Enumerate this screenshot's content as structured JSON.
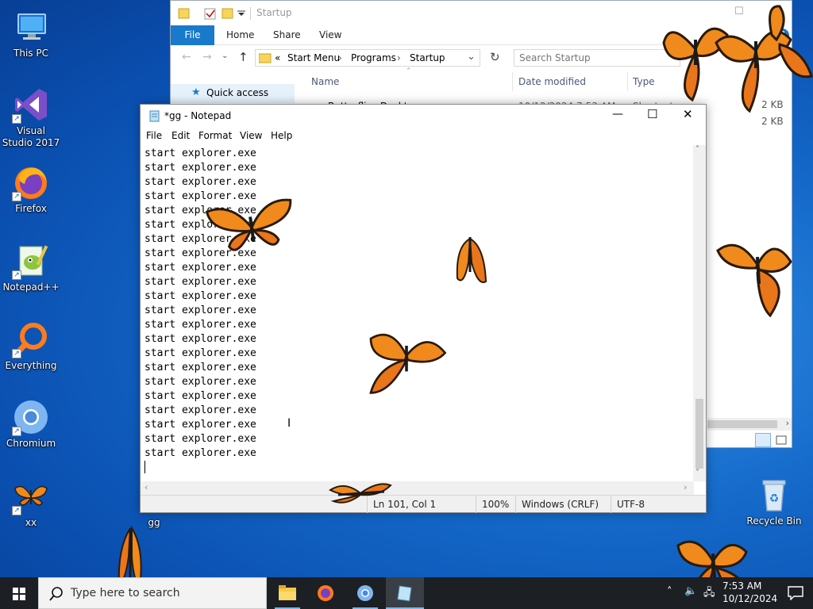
{
  "desktop": {
    "icons": [
      {
        "label": "This PC"
      },
      {
        "label": "Visual Studio 2017"
      },
      {
        "label": "Firefox"
      },
      {
        "label": "Notepad++"
      },
      {
        "label": "Everything"
      },
      {
        "label": "Chromium"
      },
      {
        "label": "xx"
      },
      {
        "label": "gg"
      },
      {
        "label": "Recycle Bin"
      }
    ]
  },
  "explorer": {
    "title": "Startup",
    "ribbon_tabs": [
      "File",
      "Home",
      "Share",
      "View"
    ],
    "address": {
      "prefix": "«",
      "segments": [
        "Start Menu",
        "Programs",
        "Startup"
      ]
    },
    "search_placeholder": "Search Startup",
    "nav_item": "Quick access",
    "columns": [
      "Name",
      "Date modified",
      "Type"
    ],
    "file_row": {
      "name": "Butterflies Deskto",
      "date": "10/12/2024 7:53 AM",
      "type": "Shortcut"
    },
    "sizes": [
      "2 KB",
      "2 KB"
    ]
  },
  "notepad": {
    "title": "*gg - Notepad",
    "menu": [
      "File",
      "Edit",
      "Format",
      "View",
      "Help"
    ],
    "line_text": "start explorer.exe",
    "line_count": 22,
    "status": {
      "position": "Ln 101, Col 1",
      "zoom": "100%",
      "eol": "Windows (CRLF)",
      "encoding": "UTF-8"
    }
  },
  "taskbar": {
    "search_placeholder": "Type here to search",
    "clock_time": "7:53 AM",
    "clock_date": "10/12/2024"
  },
  "colors": {
    "accent": "#1979ca",
    "butterfly_orange": "#f08a1c",
    "taskbar": "#1c1f24"
  }
}
